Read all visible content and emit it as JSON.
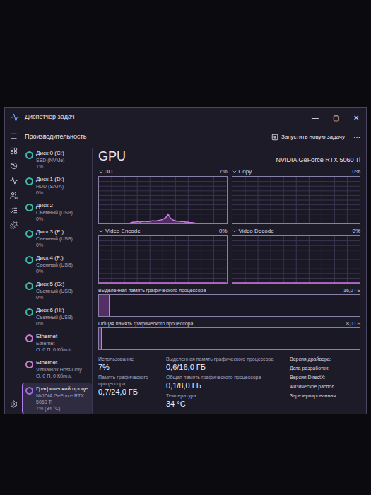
{
  "window": {
    "title": "Диспетчер задач",
    "controls": [
      "—",
      "▢",
      "✕"
    ]
  },
  "toolbar": {
    "section": "Производительность",
    "run_task": "Запустить новую задачу",
    "more": "⋯"
  },
  "sidebar": {
    "items": [
      {
        "name": "Диск 0 (C:)",
        "sub": "SSD (NVMe)",
        "value": "1%",
        "color": "#3fb7a8",
        "selected": false
      },
      {
        "name": "Диск 1 (D:)",
        "sub": "HDD (SATA)",
        "value": "0%",
        "color": "#3fb7a8",
        "selected": false
      },
      {
        "name": "Диск 2",
        "sub": "Съемный (USB)",
        "value": "0%",
        "color": "#3fb7a8",
        "selected": false
      },
      {
        "name": "Диск 3 (E:)",
        "sub": "Съемный (USB)",
        "value": "0%",
        "color": "#3fb7a8",
        "selected": false
      },
      {
        "name": "Диск 4 (F:)",
        "sub": "Съемный (USB)",
        "value": "0%",
        "color": "#3fb7a8",
        "selected": false
      },
      {
        "name": "Диск 5 (G:)",
        "sub": "Съемный (USB)",
        "value": "0%",
        "color": "#3fb7a8",
        "selected": false
      },
      {
        "name": "Диск 6 (H:)",
        "sub": "Съемный (USB)",
        "value": "0%",
        "color": "#3fb7a8",
        "selected": false
      },
      {
        "name": "Ethernet",
        "sub": "Ethernet",
        "value": "О: 0 П: 0 Кбит/с",
        "color": "#c77bc9",
        "selected": false
      },
      {
        "name": "Ethernet",
        "sub": "VirtualBox Host-Only",
        "value": "О: 0 П: 0 Кбит/с",
        "color": "#c77bc9",
        "selected": false
      },
      {
        "name": "Графический проце",
        "sub": "NVIDIA GeForce RTX 5060 Ti",
        "value": "7% (34 °C)",
        "color": "#9b6fe0",
        "selected": true
      }
    ]
  },
  "gpu": {
    "title": "GPU",
    "model": "NVIDIA GeForce RTX 5060 Ti",
    "engines": [
      {
        "label": "3D",
        "reading": "7%",
        "values": [
          0,
          0,
          0,
          0,
          0,
          0,
          0,
          0,
          0,
          0,
          0,
          0,
          0,
          0,
          0,
          2,
          3,
          3,
          4,
          3,
          4,
          5,
          4,
          4,
          5,
          6,
          5,
          6,
          7,
          8,
          10,
          13,
          20,
          12,
          8,
          6,
          5,
          5,
          4,
          4,
          3,
          3,
          2,
          2,
          1,
          0,
          0,
          0,
          0,
          0,
          0,
          0,
          0,
          0,
          0,
          0,
          0,
          0,
          0,
          0
        ]
      },
      {
        "label": "Copy",
        "reading": "0%",
        "values": [
          0,
          0,
          0,
          0,
          0,
          0,
          0,
          0,
          0,
          0,
          0,
          0,
          0,
          0,
          0,
          0,
          0,
          0,
          0,
          0,
          0,
          0,
          0,
          0,
          0,
          0,
          0,
          0,
          0,
          0
        ]
      },
      {
        "label": "Video Encode",
        "reading": "0%",
        "values": [
          0,
          0,
          0,
          0,
          0,
          0,
          0,
          0,
          0,
          0,
          0,
          0,
          0,
          0,
          0,
          0,
          0,
          0,
          0,
          0,
          0,
          0,
          0,
          0,
          0,
          0,
          0,
          0,
          0,
          0
        ]
      },
      {
        "label": "Video Decode",
        "reading": "0%",
        "values": [
          0,
          0,
          0,
          0,
          0,
          0,
          0,
          0,
          0,
          0,
          0,
          0,
          0,
          0,
          0,
          0,
          0,
          0,
          0,
          0,
          0,
          0,
          0,
          0,
          0,
          0,
          0,
          0,
          0,
          0
        ]
      }
    ],
    "memory": [
      {
        "label": "Выделенная память графического процессора",
        "max": "16,0 ГБ",
        "level": 0.04
      },
      {
        "label": "Общая память графического процессора",
        "max": "8,0 ГБ",
        "level": 0.01
      }
    ],
    "stats": [
      [
        {
          "label": "Использование",
          "value": "7%"
        },
        {
          "label": "Память графического процессора",
          "value": "0,7/24,0 ГБ"
        }
      ],
      [
        {
          "label": "Выделенная память графического процессора",
          "value": "0,6/16,0 ГБ"
        },
        {
          "label": "Общая память графического процессора",
          "value": "0,1/8,0 ГБ"
        },
        {
          "label": "Температура",
          "value": "34 °C"
        }
      ]
    ],
    "details": [
      "Версия драйвера:",
      "Дата разработки:",
      "Версия DirectX:",
      "Физическое распол...",
      "Зарезервированная..."
    ]
  }
}
